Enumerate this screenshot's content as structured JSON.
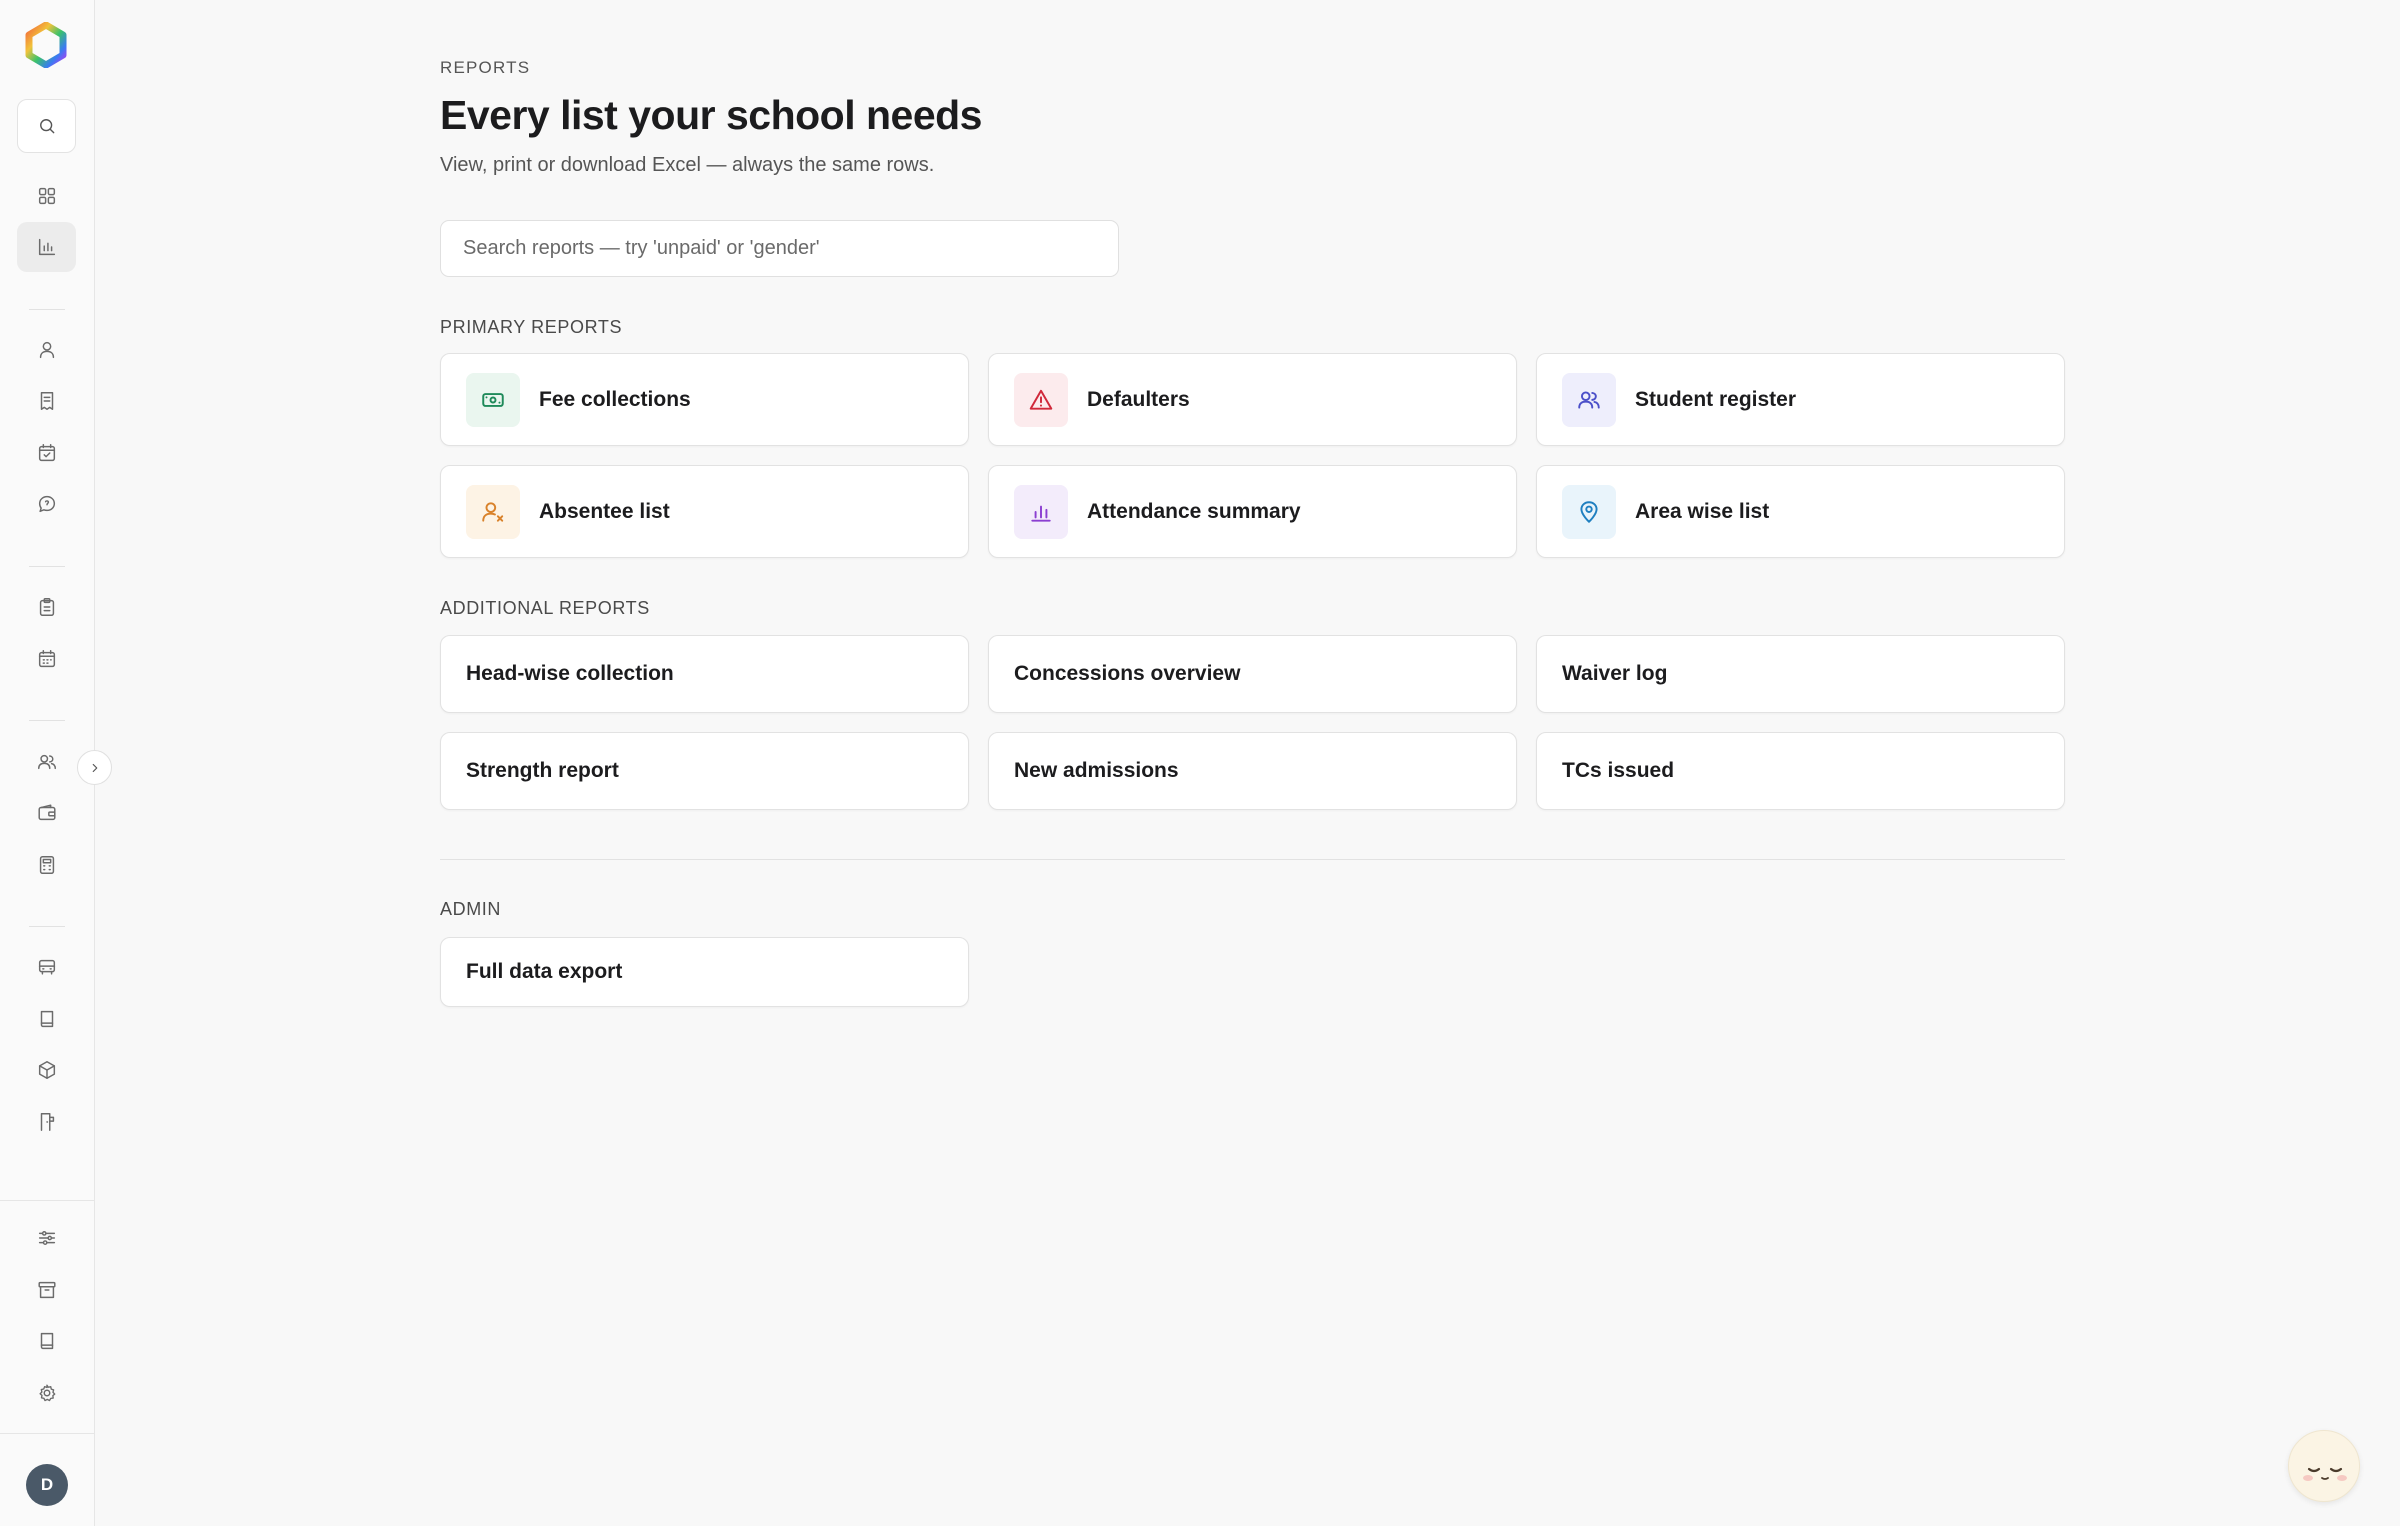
{
  "sidebar": {
    "avatar_initial": "D",
    "icons": {
      "logo": "app-logo",
      "search": "search-icon",
      "dashboard": "grid-icon",
      "reports": "bar-chart-icon",
      "students": "user-icon",
      "fees": "receipt-icon",
      "attendance": "calendar-check-icon",
      "messages": "message-icon",
      "exams": "clipboard-icon",
      "timetable": "calendar-grid-icon",
      "staff": "users-icon",
      "payroll": "wallet-icon",
      "accounts": "calculator-icon",
      "transport": "bus-icon",
      "library": "book-icon",
      "inventory": "box-icon",
      "hostel": "door-icon",
      "preferences": "sliders-icon",
      "archive": "archive-icon",
      "guide": "book-open-icon",
      "settings": "gear-icon",
      "expand": "chevron-right-icon"
    }
  },
  "header": {
    "eyebrow": "REPORTS",
    "title": "Every list your school needs",
    "subtitle": "View, print or download Excel — always the same rows."
  },
  "search": {
    "placeholder": "Search reports — try 'unpaid' or 'gender'",
    "value": ""
  },
  "primary": {
    "label": "PRIMARY REPORTS",
    "items": [
      {
        "label": "Fee collections",
        "icon": "cash-icon",
        "color": "#1f8a5a",
        "bg": "#eaf6ef"
      },
      {
        "label": "Defaulters",
        "icon": "warning-triangle-icon",
        "color": "#d0283a",
        "bg": "#fcebed"
      },
      {
        "label": "Student register",
        "icon": "users-icon",
        "color": "#4b4fc9",
        "bg": "#eeeefc"
      },
      {
        "label": "Absentee list",
        "icon": "user-x-icon",
        "color": "#d9822b",
        "bg": "#fdf3e5"
      },
      {
        "label": "Attendance summary",
        "icon": "bar-chart-icon",
        "color": "#8b3fd1",
        "bg": "#f3ecfb"
      },
      {
        "label": "Area wise list",
        "icon": "map-pin-icon",
        "color": "#1f7fc0",
        "bg": "#e9f4fb"
      }
    ]
  },
  "additional": {
    "label": "ADDITIONAL REPORTS",
    "items": [
      {
        "label": "Head-wise collection"
      },
      {
        "label": "Concessions overview"
      },
      {
        "label": "Waiver log"
      },
      {
        "label": "Strength report"
      },
      {
        "label": "New admissions"
      },
      {
        "label": "TCs issued"
      }
    ]
  },
  "admin": {
    "label": "ADMIN",
    "items": [
      {
        "label": "Full data export"
      }
    ]
  },
  "mascot": {
    "icon": "sleeping-face-icon"
  }
}
